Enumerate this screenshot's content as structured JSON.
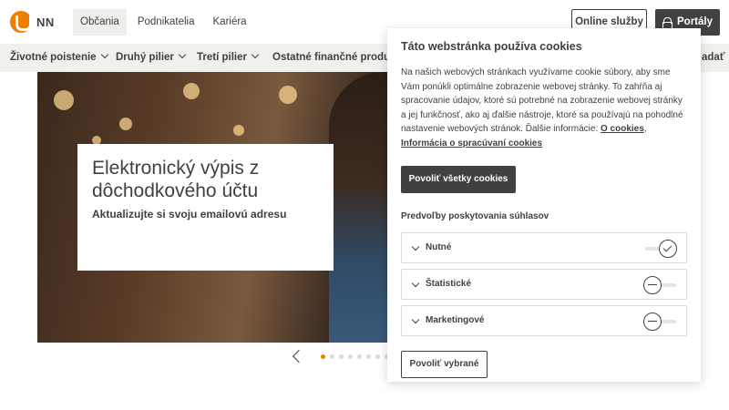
{
  "brand": {
    "name": "NN",
    "accent": "#ee7f00",
    "dark": "#414141"
  },
  "topnav": {
    "items": [
      "Občania",
      "Podnikatelia",
      "Kariéra"
    ],
    "active": "Občania"
  },
  "header_buttons": {
    "online": "Online služby",
    "portals": "Portály"
  },
  "menubar": {
    "items": [
      "Životné poistenie",
      "Druhý pilier",
      "Tretí pilier",
      "Ostatné finančné produkty",
      "adať"
    ]
  },
  "hero": {
    "title": "Elektronický výpis z dôchodkového účtu",
    "subtitle": "Aktualizujte si svoju emailovú adresu",
    "slide_count": 8,
    "active_slide": 1
  },
  "cookie": {
    "title": "Táto webstránka používa cookies",
    "body": "Na našich webových stránkach využívame cookie súbory, aby sme Vám ponúkli optimálne zobrazenie webovej stránky. To zahŕňa aj spracovanie údajov, ktoré sú potrebné na zobrazenie webovej stránky a jej funkčnosť, ako aj ďalšie nástroje, ktoré sa používajú na pohodlné nastavenie webových stránok. Ďalšie informácie:",
    "link_cookies": "O cookies",
    "link_separator": ",",
    "link_processing": "Informácia o spracúvaní cookies",
    "allow_all": "Povoliť všetky cookies",
    "pref_title": "Predvoľby poskytovania súhlasov",
    "prefs": [
      {
        "label": "Nutné",
        "enabled": true
      },
      {
        "label": "Štatistické",
        "enabled": false
      },
      {
        "label": "Marketingové",
        "enabled": false
      }
    ],
    "allow_selected": "Povoliť vybrané"
  }
}
